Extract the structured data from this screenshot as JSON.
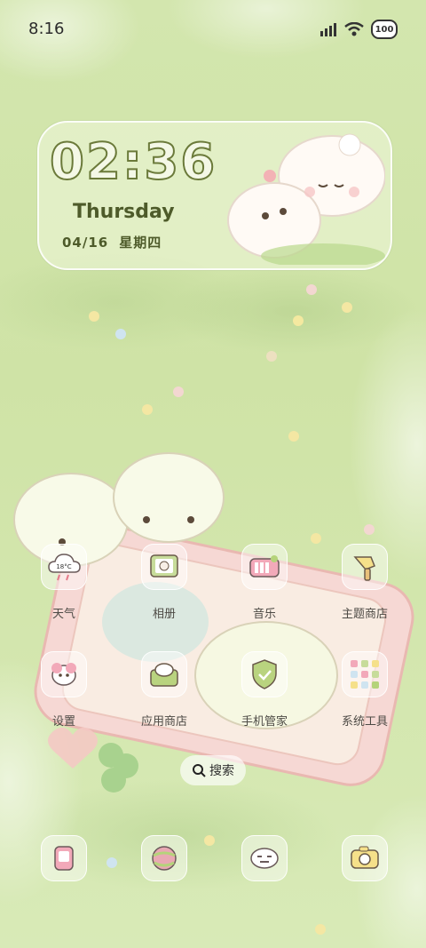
{
  "status_bar": {
    "time": "8:16",
    "battery": "100",
    "icons": [
      "signal-icon",
      "wifi-icon",
      "battery-icon"
    ]
  },
  "clock_widget": {
    "time": "02:36",
    "weekday": "Thursday",
    "date": "04/16",
    "weekday_cn": "星期四"
  },
  "apps": [
    {
      "label": "天气",
      "icon": "weather-icon",
      "extra": "18°C"
    },
    {
      "label": "相册",
      "icon": "gallery-icon"
    },
    {
      "label": "音乐",
      "icon": "music-icon"
    },
    {
      "label": "主题商店",
      "icon": "theme-store-icon"
    },
    {
      "label": "设置",
      "icon": "settings-icon"
    },
    {
      "label": "应用商店",
      "icon": "app-store-icon"
    },
    {
      "label": "手机管家",
      "icon": "phone-manager-icon"
    },
    {
      "label": "系统工具",
      "icon": "system-tools-folder-icon"
    }
  ],
  "search": {
    "label": "搜索",
    "icon": "search-icon"
  },
  "dock": [
    {
      "icon": "phone-icon"
    },
    {
      "icon": "browser-icon"
    },
    {
      "icon": "messages-icon"
    },
    {
      "icon": "camera-icon"
    }
  ],
  "colors": {
    "accent": "#6b7a3a",
    "background": "#d3e6ae"
  }
}
